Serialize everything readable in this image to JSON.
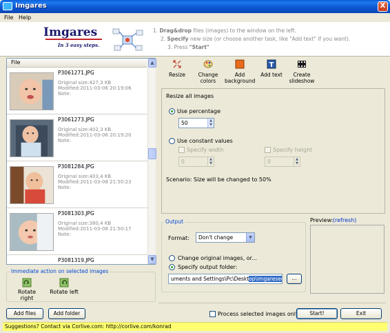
{
  "window": {
    "title": "Imgares",
    "close_label": "X"
  },
  "menu": {
    "items": [
      "File",
      "Help"
    ]
  },
  "header": {
    "logo": "Imgares",
    "tagline": "In 3 easy steps.",
    "steps": [
      {
        "num": "1.",
        "bold": "Drag&drop",
        "rest": " files (images) to the window on the left."
      },
      {
        "num": "2.",
        "bold": "Specify",
        "rest": " new size (or choose another task, like \"Add text\" if you want)."
      },
      {
        "num": "3.",
        "bold": "",
        "rest": "Press ",
        "tail_bold": "\"Start\""
      }
    ]
  },
  "filelist": {
    "column_header": "File",
    "items": [
      {
        "name": "P3061271.JPG",
        "size": "Original size:427,3 KB",
        "modified": "Modified:2011-03-06 20:19:06",
        "note": "Note:"
      },
      {
        "name": "P3061273.JPG",
        "size": "Original size:402,3 KB",
        "modified": "Modified:2011-03-06 20:19:20",
        "note": "Note:"
      },
      {
        "name": "P3081284.JPG",
        "size": "Original size:403,4 KB",
        "modified": "Modified:2011-03-08 21:50:23",
        "note": "Note:"
      },
      {
        "name": "P3081303.JPG",
        "size": "Original size:380,4 KB",
        "modified": "Modified:2011-03-08 21:50:17",
        "note": "Note:"
      },
      {
        "name": "P3081319.JPG",
        "size": "",
        "modified": "",
        "note": ""
      }
    ]
  },
  "immediate": {
    "group_label": "Immediate action on selected images",
    "rotate_right": "Rotate right",
    "rotate_left": "Rotate left"
  },
  "bottom_buttons": {
    "add_files": "Add files",
    "add_folder": "Add folder",
    "start": "Start!",
    "exit": "Exit"
  },
  "process_selected": "Process selected images only",
  "toolbar": {
    "resize": "Resize",
    "change_colors_1": "Change",
    "change_colors_2": "colors",
    "add_background_1": "Add",
    "add_background_2": "background",
    "add_text": "Add text",
    "slideshow_1": "Create",
    "slideshow_2": "slideshow"
  },
  "resize_panel": {
    "heading": "Resize all images",
    "use_percentage": "Use percentage",
    "percentage_value": "50",
    "use_constant": "Use constant values",
    "specify_width": "Specify width",
    "specify_height": "Specify height",
    "width_value": "0",
    "height_value": "0",
    "scenario": "Scenario: Size will be changed to 50%"
  },
  "output": {
    "group_label": "Output",
    "format_label": "Format:",
    "format_value": "Don't change",
    "change_original": "Change original images, or...",
    "specify_folder": "Specify output folder:",
    "folder_path_plain": "uments and Settings\\Pc\\Deskt",
    "folder_path_selected": "op\\imgaresed",
    "browse": "..."
  },
  "preview": {
    "label": "Preview:",
    "refresh": "(refresh)"
  },
  "status": {
    "text": "Suggestions? Contact via Corlive.com: http://corlive.com/konrad"
  },
  "colors": {
    "title_blue": "#0a5fd8",
    "link_blue": "#0033cc",
    "status_yellow": "#ffff70",
    "group_label_blue": "#0046d5"
  }
}
